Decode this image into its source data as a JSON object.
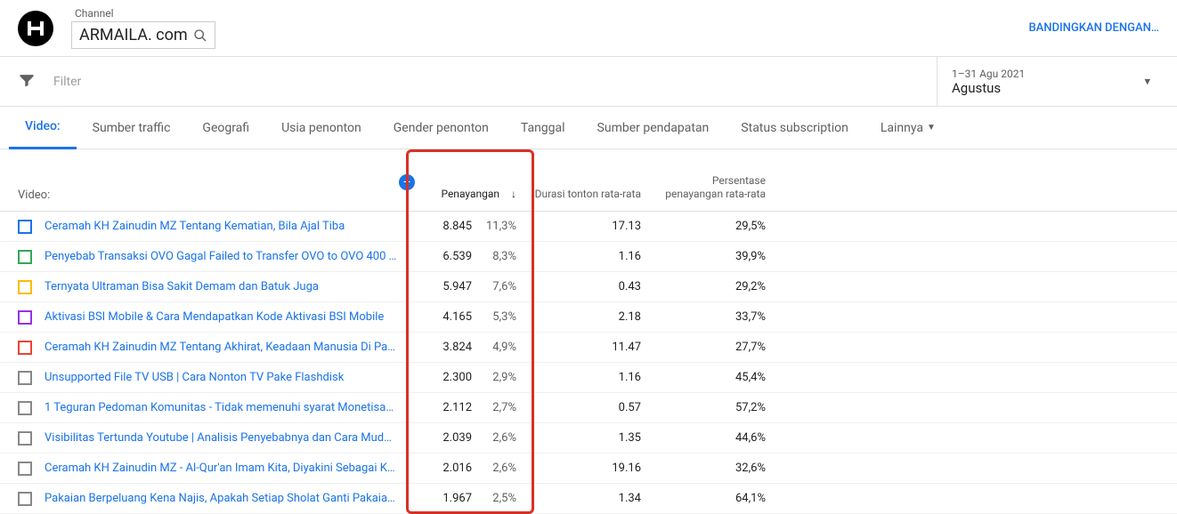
{
  "header": {
    "channel_label": "Channel",
    "channel_name": "ARMAILA. com",
    "compare": "BANDINGKAN DENGAN…"
  },
  "filter": {
    "placeholder": "Filter",
    "date_range": "1–31 Agu 2021",
    "date_month": "Agustus"
  },
  "tabs": {
    "active": "Video:",
    "items": [
      "Sumber traffic",
      "Geografi",
      "Usia penonton",
      "Gender penonton",
      "Tanggal",
      "Sumber pendapatan",
      "Status subscription"
    ],
    "more": "Lainnya"
  },
  "columns": {
    "video": "Video:",
    "views": "Penayangan",
    "duration": "Durasi tonton rata-rata",
    "percent": "Persentase penayangan rata-rata"
  },
  "rows": [
    {
      "color": "#1a73e8",
      "title": "Ceramah KH Zainudin MZ Tentang Kematian, Bila Ajal Tiba",
      "views": "8.845",
      "views_pct": "11,3%",
      "duration": "17.13",
      "percent": "29,5%"
    },
    {
      "color": "#34a853",
      "title": "Penyebab Transaksi OVO Gagal Failed to Transfer OVO to OVO 400 …",
      "views": "6.539",
      "views_pct": "8,3%",
      "duration": "1.16",
      "percent": "39,9%"
    },
    {
      "color": "#fbbc04",
      "title": "Ternyata Ultraman Bisa Sakit Demam dan Batuk Juga",
      "views": "5.947",
      "views_pct": "7,6%",
      "duration": "0.43",
      "percent": "29,2%"
    },
    {
      "color": "#9334e6",
      "title": "Aktivasi BSI Mobile & Cara Mendapatkan Kode Aktivasi BSI Mobile",
      "views": "4.165",
      "views_pct": "5,3%",
      "duration": "2.18",
      "percent": "33,7%"
    },
    {
      "color": "#ea4335",
      "title": "Ceramah KH Zainudin MZ Tentang Akhirat, Keadaan Manusia Di Pa…",
      "views": "3.824",
      "views_pct": "4,9%",
      "duration": "11.47",
      "percent": "27,7%"
    },
    {
      "color": "#888",
      "title": "Unsupported File TV USB | Cara Nonton TV Pake Flashdisk",
      "views": "2.300",
      "views_pct": "2,9%",
      "duration": "1.16",
      "percent": "45,4%"
    },
    {
      "color": "#888",
      "title": "1 Teguran Pedoman Komunitas - Tidak memenuhi syarat Monetisa…",
      "views": "2.112",
      "views_pct": "2,7%",
      "duration": "0.57",
      "percent": "57,2%"
    },
    {
      "color": "#888",
      "title": "Visibilitas Tertunda Youtube | Analisis Penyebabnya dan Cara Mud…",
      "views": "2.039",
      "views_pct": "2,6%",
      "duration": "1.35",
      "percent": "44,6%"
    },
    {
      "color": "#888",
      "title": "Ceramah KH Zainudin MZ - Al-Qur'an Imam Kita, Diyakini Sebagai K…",
      "views": "2.016",
      "views_pct": "2,6%",
      "duration": "19.16",
      "percent": "32,6%"
    },
    {
      "color": "#888",
      "title": "Pakaian Berpeluang Kena Najis, Apakah Setiap Sholat Ganti Pakaia…",
      "views": "1.967",
      "views_pct": "2,5%",
      "duration": "1.34",
      "percent": "64,1%"
    }
  ]
}
